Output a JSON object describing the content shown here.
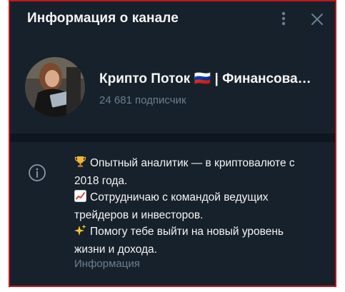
{
  "header": {
    "title": "Информация о канале",
    "more_icon": "more-vertical-icon",
    "close_icon": "close-icon"
  },
  "profile": {
    "channel_name": "Крипто Поток 🇷🇺 | Финансова…",
    "subscribers": "24 681 подписчик"
  },
  "info": {
    "icon": "info-icon",
    "bio_lines": [
      "Опытный аналитик — в криптовалюте с",
      "2018 года.",
      "Сотрудничаю с командой ведущих",
      "трейдеров и инвесторов.",
      "Помогу тебе выйти на новый уровень",
      "жизни и дохода."
    ],
    "label": "Информация"
  },
  "colors": {
    "background": "#17212b",
    "separator": "#0e1621",
    "text_primary": "#f5f5f5",
    "text_secondary": "#6d7f8f",
    "frame_border": "#c4161c"
  }
}
